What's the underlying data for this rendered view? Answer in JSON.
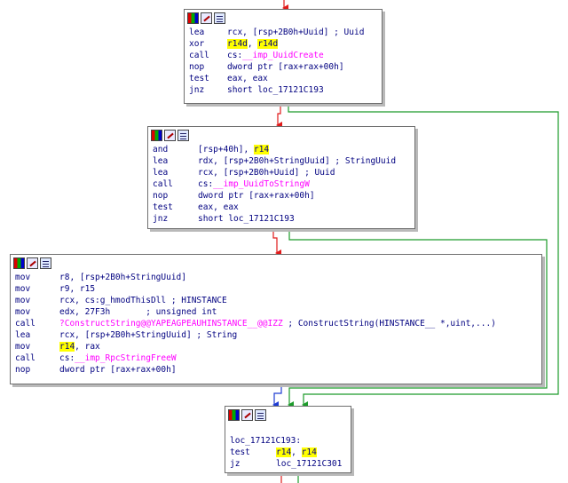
{
  "blocks": [
    {
      "lines": [
        [
          {
            "t": "lea",
            "k": "mn"
          },
          {
            "t": "rcx, [rsp+2B0h+Uuid] ; Uuid"
          }
        ],
        [
          {
            "t": "xor",
            "k": "mn"
          },
          {
            "t": "r14d",
            "k": "hl"
          },
          {
            "t": ", "
          },
          {
            "t": "r14d",
            "k": "hl"
          }
        ],
        [
          {
            "t": "call",
            "k": "mn"
          },
          {
            "t": "cs:"
          },
          {
            "t": "__imp_UuidCreate",
            "k": "imp"
          }
        ],
        [
          {
            "t": "nop",
            "k": "mn"
          },
          {
            "t": "dword ptr [rax+rax+00h]"
          }
        ],
        [
          {
            "t": "test",
            "k": "mn"
          },
          {
            "t": "eax, eax"
          }
        ],
        [
          {
            "t": "jnz",
            "k": "mn"
          },
          {
            "t": "short loc_17121C193"
          }
        ]
      ]
    },
    {
      "lines": [
        [
          {
            "t": "and",
            "k": "mn"
          },
          {
            "t": "[rsp+40h], "
          },
          {
            "t": "r14",
            "k": "hl"
          }
        ],
        [
          {
            "t": "lea",
            "k": "mn"
          },
          {
            "t": "rdx, [rsp+2B0h+StringUuid] ; StringUuid"
          }
        ],
        [
          {
            "t": "lea",
            "k": "mn"
          },
          {
            "t": "rcx, [rsp+2B0h+Uuid] ; Uuid"
          }
        ],
        [
          {
            "t": "call",
            "k": "mn"
          },
          {
            "t": "cs:"
          },
          {
            "t": "__imp_UuidToStringW",
            "k": "imp"
          }
        ],
        [
          {
            "t": "nop",
            "k": "mn"
          },
          {
            "t": "dword ptr [rax+rax+00h]"
          }
        ],
        [
          {
            "t": "test",
            "k": "mn"
          },
          {
            "t": "eax, eax"
          }
        ],
        [
          {
            "t": "jnz",
            "k": "mn"
          },
          {
            "t": "short loc_17121C193"
          }
        ]
      ]
    },
    {
      "lines": [
        [
          {
            "t": "mov",
            "k": "mn"
          },
          {
            "t": "r8, [rsp+2B0h+StringUuid]"
          }
        ],
        [
          {
            "t": "mov",
            "k": "mn"
          },
          {
            "t": "r9, r15"
          }
        ],
        [
          {
            "t": "mov",
            "k": "mn"
          },
          {
            "t": "rcx, cs:g_hmodThisDll ; HINSTANCE"
          }
        ],
        [
          {
            "t": "mov",
            "k": "mn"
          },
          {
            "t": "edx, 27F3h       ; unsigned int"
          }
        ],
        [
          {
            "t": "call",
            "k": "mn"
          },
          {
            "t": "?ConstructString@@YAPEAGPEAUHINSTANCE__@@IZZ",
            "k": "imp"
          },
          {
            "t": " ; ConstructString(HINSTANCE__ *,uint,...)",
            "k": "cmt"
          }
        ],
        [
          {
            "t": "lea",
            "k": "mn"
          },
          {
            "t": "rcx, [rsp+2B0h+StringUuid] ; String"
          }
        ],
        [
          {
            "t": "mov",
            "k": "mn"
          },
          {
            "t": "r14",
            "k": "hl"
          },
          {
            "t": ", rax"
          }
        ],
        [
          {
            "t": "call",
            "k": "mn"
          },
          {
            "t": "cs:"
          },
          {
            "t": "__imp_RpcStringFreeW",
            "k": "imp"
          }
        ],
        [
          {
            "t": "nop",
            "k": "mn"
          },
          {
            "t": "dword ptr [rax+rax+00h]"
          }
        ]
      ]
    },
    {
      "lines": [
        [
          {
            "t": ""
          }
        ],
        [
          {
            "t": "loc_17121C193:",
            "k": "lbl"
          }
        ],
        [
          {
            "t": "test",
            "k": "mn"
          },
          {
            "t": "r14",
            "k": "hl"
          },
          {
            "t": ", "
          },
          {
            "t": "r14",
            "k": "hl"
          }
        ],
        [
          {
            "t": "jz",
            "k": "mn"
          },
          {
            "t": "loc_17121C301"
          }
        ]
      ]
    }
  ],
  "colors": {
    "edge_true": "#1c9b2a",
    "edge_false": "#e01a1a",
    "edge_uncond": "#1e3cd2",
    "highlight": "#ffff00",
    "import": "#ff00ff",
    "text": "#000080"
  },
  "icons": [
    "graph-overview-icon",
    "edit-color-icon",
    "list-view-icon"
  ]
}
